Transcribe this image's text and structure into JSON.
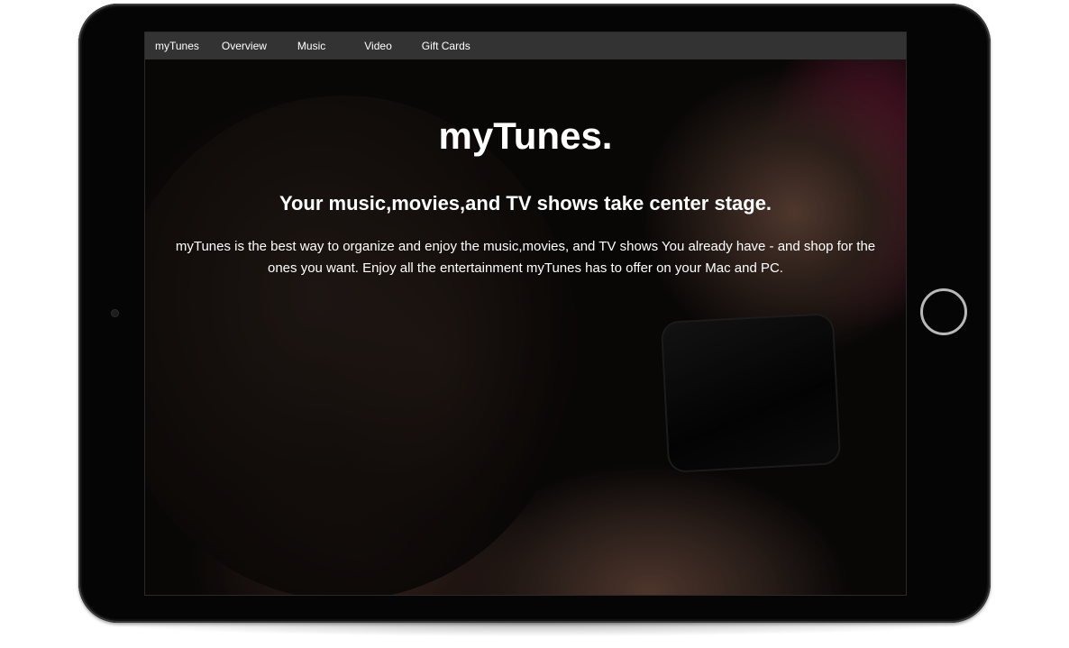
{
  "nav": {
    "brand": "myTunes",
    "items": [
      {
        "label": "Overview"
      },
      {
        "label": "Music"
      },
      {
        "label": "Video"
      },
      {
        "label": "Gift Cards"
      }
    ]
  },
  "hero": {
    "title": "myTunes.",
    "subtitle": "Your music,movies,and TV shows take center stage.",
    "description": "myTunes is the best way to organize and enjoy the music,movies, and TV shows You already have - and shop for the ones you want. Enjoy all the entertainment myTunes has to offer on your Mac and PC."
  },
  "colors": {
    "navbar_bg": "#333333",
    "text": "#ffffff",
    "device_frame": "#050505"
  }
}
